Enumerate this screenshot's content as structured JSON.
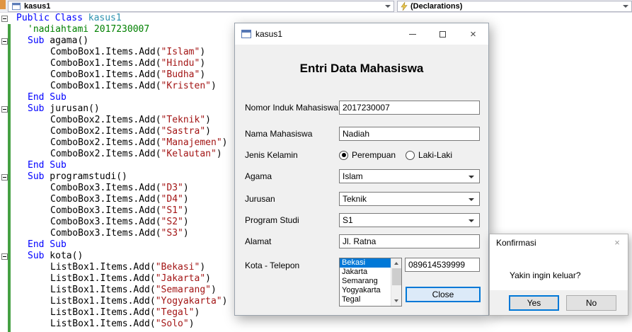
{
  "navbar": {
    "scope_dropdown": {
      "label": "kasus1"
    },
    "member_dropdown": {
      "label": "(Declarations)"
    }
  },
  "editor": {
    "lines": [
      {
        "fold": true,
        "indent": 0,
        "parts": [
          [
            "Public Class ",
            "kw"
          ],
          [
            "kasus1",
            "type"
          ]
        ]
      },
      {
        "fold": false,
        "indent": 1,
        "parts": [
          [
            "'nadiahtami 2017230007",
            "cm"
          ]
        ]
      },
      {
        "fold": true,
        "indent": 1,
        "parts": [
          [
            "Sub",
            "kw"
          ],
          [
            " agama()",
            "pl"
          ]
        ]
      },
      {
        "fold": false,
        "indent": 2,
        "parts": [
          [
            "ComboBox1.Items.Add(",
            "pl"
          ],
          [
            "\"Islam\"",
            "st"
          ],
          [
            ")",
            "pl"
          ]
        ]
      },
      {
        "fold": false,
        "indent": 2,
        "parts": [
          [
            "ComboBox1.Items.Add(",
            "pl"
          ],
          [
            "\"Hindu\"",
            "st"
          ],
          [
            ")",
            "pl"
          ]
        ]
      },
      {
        "fold": false,
        "indent": 2,
        "parts": [
          [
            "ComboBox1.Items.Add(",
            "pl"
          ],
          [
            "\"Budha\"",
            "st"
          ],
          [
            ")",
            "pl"
          ]
        ]
      },
      {
        "fold": false,
        "indent": 2,
        "parts": [
          [
            "ComboBox1.Items.Add(",
            "pl"
          ],
          [
            "\"Kristen\"",
            "st"
          ],
          [
            ")",
            "pl"
          ]
        ]
      },
      {
        "fold": false,
        "indent": 1,
        "parts": [
          [
            "End Sub",
            "kw"
          ]
        ]
      },
      {
        "fold": true,
        "indent": 1,
        "parts": [
          [
            "Sub",
            "kw"
          ],
          [
            " jurusan()",
            "pl"
          ]
        ]
      },
      {
        "fold": false,
        "indent": 2,
        "parts": [
          [
            "ComboBox2.Items.Add(",
            "pl"
          ],
          [
            "\"Teknik\"",
            "st"
          ],
          [
            ")",
            "pl"
          ]
        ]
      },
      {
        "fold": false,
        "indent": 2,
        "parts": [
          [
            "ComboBox2.Items.Add(",
            "pl"
          ],
          [
            "\"Sastra\"",
            "st"
          ],
          [
            ")",
            "pl"
          ]
        ]
      },
      {
        "fold": false,
        "indent": 2,
        "parts": [
          [
            "ComboBox2.Items.Add(",
            "pl"
          ],
          [
            "\"Manajemen\"",
            "st"
          ],
          [
            ")",
            "pl"
          ]
        ]
      },
      {
        "fold": false,
        "indent": 2,
        "parts": [
          [
            "ComboBox2.Items.Add(",
            "pl"
          ],
          [
            "\"Kelautan\"",
            "st"
          ],
          [
            ")",
            "pl"
          ]
        ]
      },
      {
        "fold": false,
        "indent": 1,
        "parts": [
          [
            "End Sub",
            "kw"
          ]
        ]
      },
      {
        "fold": true,
        "indent": 1,
        "parts": [
          [
            "Sub",
            "kw"
          ],
          [
            " programstudi()",
            "pl"
          ]
        ]
      },
      {
        "fold": false,
        "indent": 2,
        "parts": [
          [
            "ComboBox3.Items.Add(",
            "pl"
          ],
          [
            "\"D3\"",
            "st"
          ],
          [
            ")",
            "pl"
          ]
        ]
      },
      {
        "fold": false,
        "indent": 2,
        "parts": [
          [
            "ComboBox3.Items.Add(",
            "pl"
          ],
          [
            "\"D4\"",
            "st"
          ],
          [
            ")",
            "pl"
          ]
        ]
      },
      {
        "fold": false,
        "indent": 2,
        "parts": [
          [
            "ComboBox3.Items.Add(",
            "pl"
          ],
          [
            "\"S1\"",
            "st"
          ],
          [
            ")",
            "pl"
          ]
        ]
      },
      {
        "fold": false,
        "indent": 2,
        "parts": [
          [
            "ComboBox3.Items.Add(",
            "pl"
          ],
          [
            "\"S2\"",
            "st"
          ],
          [
            ")",
            "pl"
          ]
        ]
      },
      {
        "fold": false,
        "indent": 2,
        "parts": [
          [
            "ComboBox3.Items.Add(",
            "pl"
          ],
          [
            "\"S3\"",
            "st"
          ],
          [
            ")",
            "pl"
          ]
        ]
      },
      {
        "fold": false,
        "indent": 1,
        "parts": [
          [
            "End Sub",
            "kw"
          ]
        ]
      },
      {
        "fold": true,
        "indent": 1,
        "parts": [
          [
            "Sub",
            "kw"
          ],
          [
            " kota()",
            "pl"
          ]
        ]
      },
      {
        "fold": false,
        "indent": 2,
        "parts": [
          [
            "ListBox1.Items.Add(",
            "pl"
          ],
          [
            "\"Bekasi\"",
            "st"
          ],
          [
            ")",
            "pl"
          ]
        ]
      },
      {
        "fold": false,
        "indent": 2,
        "parts": [
          [
            "ListBox1.Items.Add(",
            "pl"
          ],
          [
            "\"Jakarta\"",
            "st"
          ],
          [
            ")",
            "pl"
          ]
        ]
      },
      {
        "fold": false,
        "indent": 2,
        "parts": [
          [
            "ListBox1.Items.Add(",
            "pl"
          ],
          [
            "\"Semarang\"",
            "st"
          ],
          [
            ")",
            "pl"
          ]
        ]
      },
      {
        "fold": false,
        "indent": 2,
        "parts": [
          [
            "ListBox1.Items.Add(",
            "pl"
          ],
          [
            "\"Yogyakarta\"",
            "st"
          ],
          [
            ")",
            "pl"
          ]
        ]
      },
      {
        "fold": false,
        "indent": 2,
        "parts": [
          [
            "ListBox1.Items.Add(",
            "pl"
          ],
          [
            "\"Tegal\"",
            "st"
          ],
          [
            ")",
            "pl"
          ]
        ]
      },
      {
        "fold": false,
        "indent": 2,
        "parts": [
          [
            "ListBox1.Items.Add(",
            "pl"
          ],
          [
            "\"Solo\"",
            "st"
          ],
          [
            ")",
            "pl"
          ]
        ]
      }
    ],
    "token_colors": {
      "keyword": "#0000ff",
      "type": "#2b91af",
      "comment": "#008000",
      "string": "#a31515"
    },
    "change_bar_color": "#45a043"
  },
  "form": {
    "title": "kasus1",
    "heading": "Entri Data Mahasiswa",
    "rows": {
      "nim": {
        "label": "Nomor Induk Mahasiswa",
        "value": "2017230007"
      },
      "nama": {
        "label": "Nama Mahasiswa",
        "value": "Nadiah"
      },
      "jenis_kelamin": {
        "label": "Jenis Kelamin",
        "options": [
          "Perempuan",
          "Laki-Laki"
        ],
        "selected": "Perempuan"
      },
      "agama": {
        "label": "Agama",
        "value": "Islam"
      },
      "jurusan": {
        "label": "Jurusan",
        "value": "Teknik"
      },
      "program_studi": {
        "label": "Program Studi",
        "value": "S1"
      },
      "alamat": {
        "label": "Alamat",
        "value": "Jl. Ratna"
      },
      "kota_telepon": {
        "label": "Kota - Telepon",
        "kota_items": [
          "Bekasi",
          "Jakarta",
          "Semarang",
          "Yogyakarta",
          "Tegal"
        ],
        "kota_selected": "Bekasi",
        "telepon": "089614539999"
      }
    },
    "close_button": "Close",
    "selection_color": "#0078d7"
  },
  "confirm_dialog": {
    "title": "Konfirmasi",
    "message": "Yakin ingin keluar?",
    "yes_button": "Yes",
    "no_button": "No"
  }
}
